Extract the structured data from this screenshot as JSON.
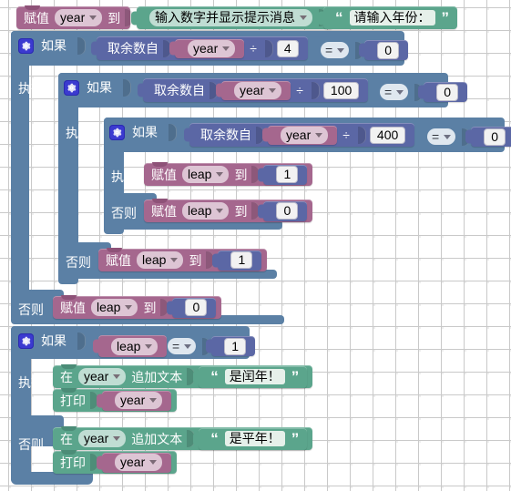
{
  "workspace": {
    "app": "Blockly",
    "background_color": "#ffffff",
    "grid_dot_color": "#bdbdbd",
    "palette": {
      "variables": "#a5678e",
      "control": "#5b80a5",
      "math": "#5b67a5",
      "text": "#5ba58c",
      "logic": "#5b80a5",
      "gear": "#3b3ad0"
    }
  },
  "labels": {
    "set": "赋值",
    "to": "到",
    "if": "如果",
    "do": "执行",
    "else": "否则",
    "modulo": "取余数自",
    "divide": "÷",
    "equals": "=",
    "append_text_a": "在",
    "append_text_b": "追加文本",
    "print": "打印",
    "prompt_number": "输入数字并显示提示消息"
  },
  "variables": {
    "year": "year",
    "leap": "leap"
  },
  "values": {
    "n0": "0",
    "n1": "1",
    "n4": "4",
    "n100": "100",
    "n400": "400"
  },
  "strings": {
    "prompt_year": "请输入年份：",
    "is_leap": "是闰年！",
    "is_common": "是平年！"
  },
  "blocks": [
    {
      "id": "set-year",
      "type": "variables_set",
      "text": "赋值 year 到 输入数字并显示提示消息 “请输入年份：”"
    },
    {
      "id": "if-year-mod-4",
      "type": "controls_if",
      "condition": "取余数自 year ÷ 4 = 0"
    },
    {
      "id": "if-year-mod-100",
      "type": "controls_if",
      "condition": "取余数自 year ÷ 100 = 0"
    },
    {
      "id": "if-year-mod-400",
      "type": "controls_if",
      "condition": "取余数自 year ÷ 400 = 0"
    },
    {
      "id": "set-leap-1-inner",
      "type": "variables_set",
      "text": "赋值 leap 到 1"
    },
    {
      "id": "set-leap-0-inner",
      "type": "variables_set",
      "text": "赋值 leap 到 0"
    },
    {
      "id": "set-leap-1-mid",
      "type": "variables_set",
      "text": "赋值 leap 到 1"
    },
    {
      "id": "set-leap-0-outer",
      "type": "variables_set",
      "text": "赋值 leap 到 0"
    },
    {
      "id": "if-leap-eq-1",
      "type": "controls_if",
      "condition": "leap = 1"
    },
    {
      "id": "append-leap",
      "type": "text_append",
      "text": "在 year 追加文本 “是闰年！”"
    },
    {
      "id": "print-leap",
      "type": "text_print",
      "text": "打印 year"
    },
    {
      "id": "append-common",
      "type": "text_append",
      "text": "在 year 追加文本 “是平年！”"
    },
    {
      "id": "print-common",
      "type": "text_print",
      "text": "打印 year"
    }
  ]
}
